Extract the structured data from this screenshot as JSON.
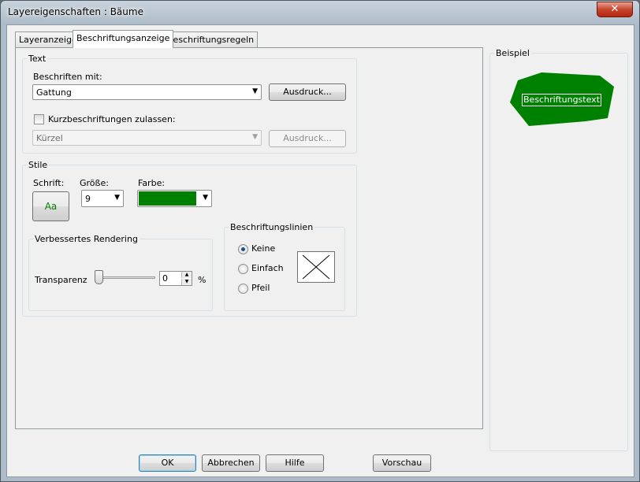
{
  "window": {
    "title": "Layereigenschaften  : Bäume",
    "close_label": "✕"
  },
  "tabs": [
    {
      "label": "Layeranzeige"
    },
    {
      "label": "Beschriftungsanzeige"
    },
    {
      "label": "Beschriftungsregeln"
    }
  ],
  "text_group": {
    "legend": "Text",
    "label_with": "Beschriften mit:",
    "label_field_value": "Gattung",
    "expression_button": "Ausdruck...",
    "short_labels_checkbox": "Kurzbeschriftungen zulassen:",
    "short_labels_checked": false,
    "short_field_value": "Kürzel",
    "short_expression_button": "Ausdruck..."
  },
  "styles_group": {
    "legend": "Stile",
    "font_label": "Schrift:",
    "font_button": "Aa",
    "size_label": "Größe:",
    "size_value": "9",
    "color_label": "Farbe:",
    "color_value": "#008000",
    "rendering_legend": "Verbessertes Rendering",
    "transparency_label": "Transparenz",
    "transparency_value": "0",
    "transparency_unit": "%",
    "leader_lines": {
      "legend": "Beschriftungslinien",
      "options": [
        {
          "label": "Keine",
          "checked": true
        },
        {
          "label": "Einfach",
          "checked": false
        },
        {
          "label": "Pfeil",
          "checked": false
        }
      ]
    }
  },
  "preview": {
    "legend": "Beispiel",
    "sample_text": "Beschriftungstext",
    "polygon_color": "#008000"
  },
  "footer": {
    "ok": "OK",
    "cancel": "Abbrechen",
    "help": "Hilfe",
    "preview": "Vorschau"
  }
}
